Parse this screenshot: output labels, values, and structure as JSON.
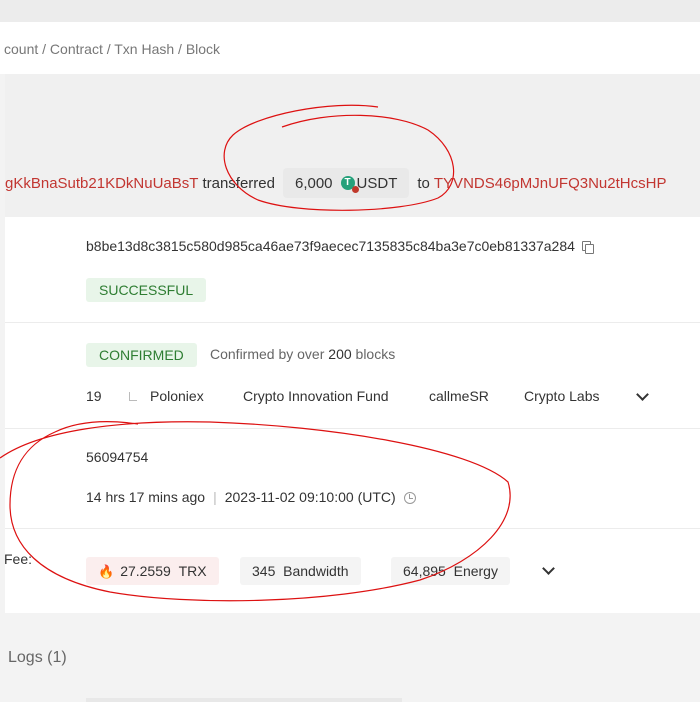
{
  "breadcrumb": {
    "text": "count / Contract / Txn Hash / Block"
  },
  "transfer": {
    "from_address": "gKkBnaSutb21KDkNuUaBsT",
    "verb": "transferred",
    "amount": "6,000",
    "token": "USDT",
    "token_icon": "tether-icon",
    "preposition": "to",
    "to_address": "TYVNDS46pMJnUFQ3Nu2tHcsHP"
  },
  "hash": {
    "value": "b8be13d8c3815c580d985ca46ae73f9aecec7135835c84ba3e7c0eb81337a284"
  },
  "status": {
    "label": "SUCCESSFUL"
  },
  "confirmation": {
    "label": "CONFIRMED",
    "text_prefix": "Confirmed by over ",
    "count": "200",
    "text_suffix": " blocks"
  },
  "sr_list": {
    "count": "19",
    "items": [
      "Poloniex",
      "Crypto Innovation Fund",
      "callmeSR",
      "Crypto Labs"
    ]
  },
  "block": {
    "number": "56094754",
    "age": "14 hrs 17 mins ago",
    "timestamp": "2023-11-02 09:10:00 (UTC)"
  },
  "fees": {
    "label": "Fee:",
    "trx_value": "27.2559",
    "trx_unit": "TRX",
    "bandwidth_value": "345",
    "bandwidth_unit": "Bandwidth",
    "energy_value": "64,895",
    "energy_unit": "Energy"
  },
  "logs": {
    "title": "Logs (1)"
  },
  "colors": {
    "address": "#c23631",
    "success_bg": "#e8f5e9",
    "success_fg": "#2e7d32",
    "annotation": "#d11"
  }
}
